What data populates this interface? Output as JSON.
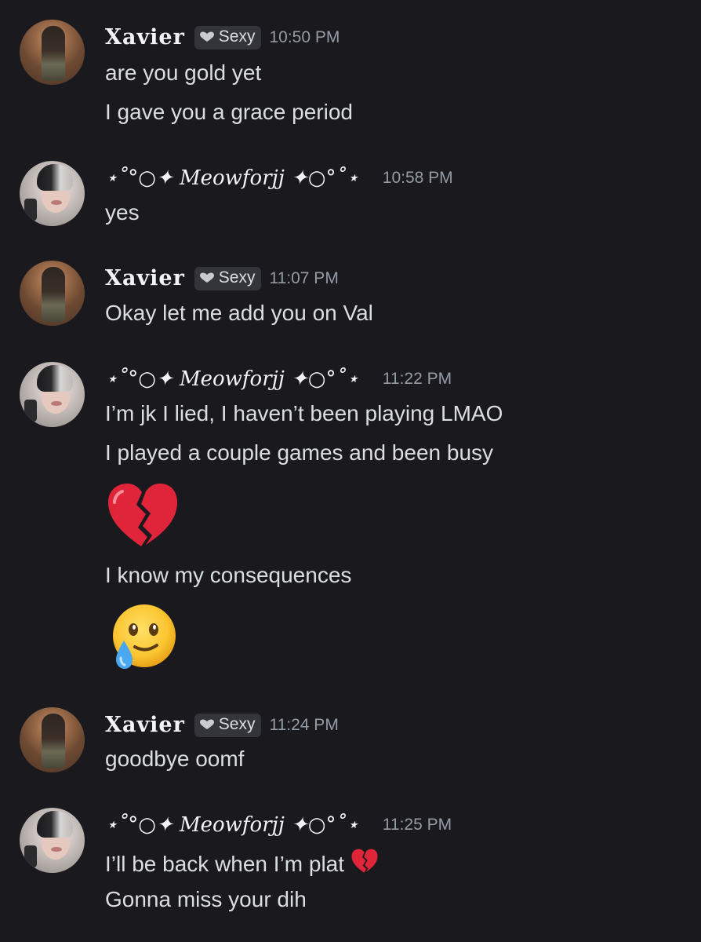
{
  "messages": [
    {
      "author": "Xavier",
      "tag": "Sexy",
      "time": "10:50 PM",
      "lines": [
        "are you gold yet",
        "I gave you a grace period"
      ]
    },
    {
      "author": "⋆˚°○✦ Meowforjj ✦○°˚⋆",
      "time": "10:58 PM",
      "lines": [
        "yes"
      ]
    },
    {
      "author": "Xavier",
      "tag": "Sexy",
      "time": "11:07 PM",
      "lines": [
        "Okay let me add you on Val"
      ]
    },
    {
      "author": "⋆˚°○✦ Meowforjj ✦○°˚⋆",
      "time": "11:22 PM",
      "lines": [
        "I’m jk I lied, I haven’t been playing LMAO",
        "I played a couple games and been busy",
        "broken-heart-emoji",
        "I know my consequences",
        "face-holding-back-tears-emoji"
      ]
    },
    {
      "author": "Xavier",
      "tag": "Sexy",
      "time": "11:24 PM",
      "lines": [
        "goodbye oomf"
      ]
    },
    {
      "author": "⋆˚°○✦ Meowforjj ✦○°˚⋆",
      "time": "11:25 PM",
      "lines": [
        "I’ll be back when I’m plat",
        "Gonna miss your dih"
      ]
    }
  ],
  "colors": {
    "background": "#1a1a1e",
    "text": "#dbdee1",
    "name": "#f2f3f5",
    "timestamp": "#949ba4",
    "tag_bg": "#34343b",
    "heart_red": "#e0253a"
  }
}
